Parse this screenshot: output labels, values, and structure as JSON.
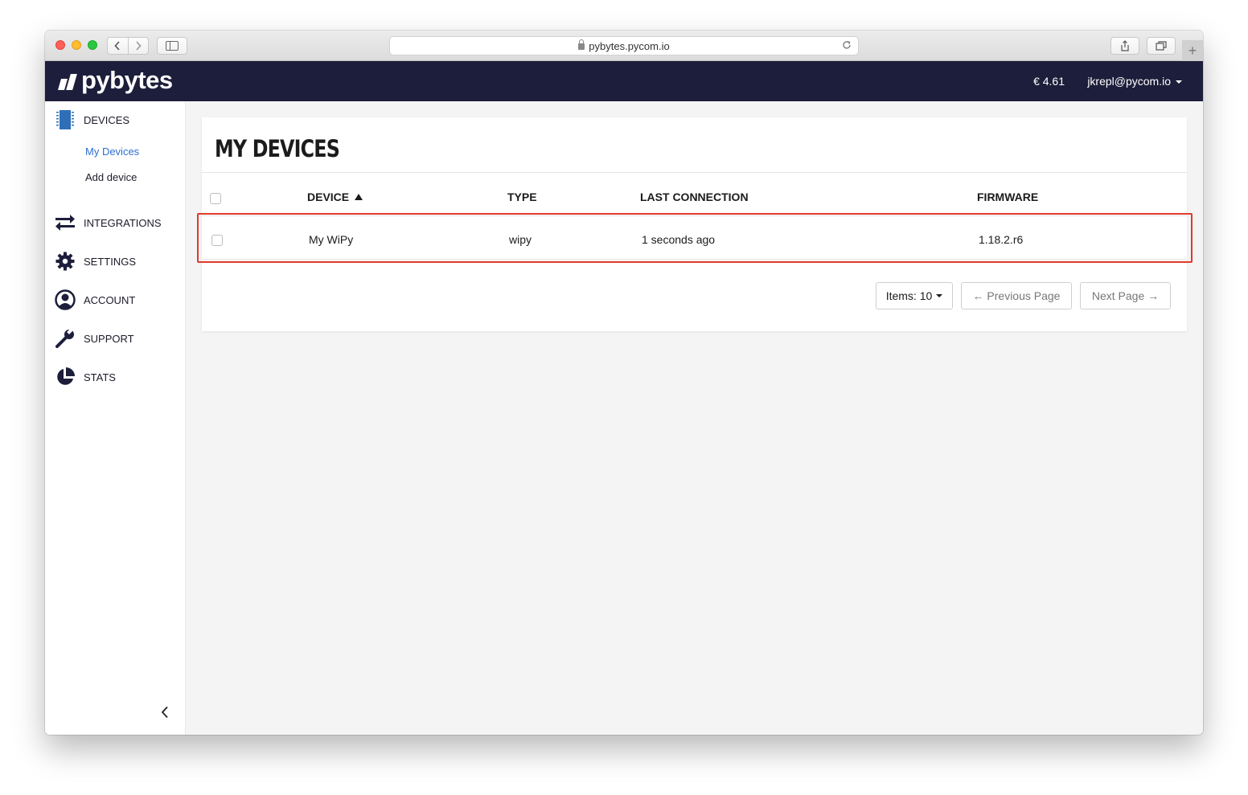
{
  "browser": {
    "url": "pybytes.pycom.io",
    "back_icon": "chevron-left",
    "forward_icon": "chevron-right",
    "reload_icon": "reload",
    "share_icon": "share",
    "tabs_icon": "tabs",
    "new_tab": "+"
  },
  "header": {
    "logo_text": "pybytes",
    "balance": "€ 4.61",
    "user": "jkrepl@pycom.io",
    "bg_color": "#1d1e3b"
  },
  "sidebar": {
    "devices": "DEVICES",
    "sub_items": [
      {
        "label": "My Devices",
        "active": true
      },
      {
        "label": "Add device",
        "active": false
      }
    ],
    "integrations": "INTEGRATIONS",
    "settings": "SETTINGS",
    "account": "ACCOUNT",
    "support": "SUPPORT",
    "stats": "STATS",
    "collapse_icon": "chevron-left",
    "active_color": "#2d6fd1"
  },
  "main": {
    "title": "MY DEVICES",
    "columns": {
      "device": "DEVICE",
      "type": "TYPE",
      "last_connection": "LAST CONNECTION",
      "firmware": "FIRMWARE"
    },
    "rows": [
      {
        "device": "My WiPy",
        "type": "wipy",
        "last_connection": "1 seconds ago",
        "firmware": "1.18.2.r6"
      }
    ],
    "pagination": {
      "items": "Items: 10",
      "previous": "← Previous Page",
      "next": "Next Page →"
    },
    "highlight_color": "#e0392b"
  }
}
